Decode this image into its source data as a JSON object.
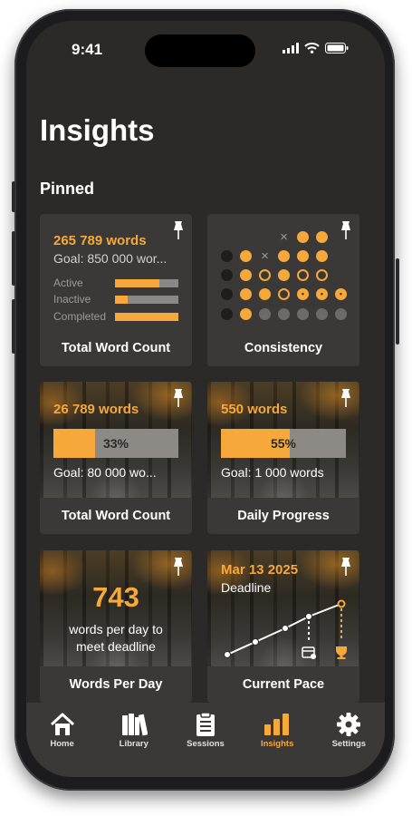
{
  "status": {
    "time": "9:41"
  },
  "page": {
    "title": "Insights",
    "section": "Pinned"
  },
  "colors": {
    "accent": "#f7a83a",
    "background": "#2b2a28",
    "card": "#3a3937"
  },
  "cards": {
    "total_word_count": {
      "headline": "265 789 words",
      "goal": "Goal: 850 000 wor...",
      "title": "Total Word Count",
      "rows": [
        {
          "label": "Active",
          "value": 0.7
        },
        {
          "label": "Inactive",
          "value": 0.2
        },
        {
          "label": "Completed",
          "value": 1.0
        }
      ]
    },
    "consistency": {
      "title": "Consistency",
      "grid": [
        [
          "none",
          "none",
          "none",
          "x",
          "filled",
          "filled"
        ],
        [
          "dark",
          "filled",
          "x",
          "filled",
          "filled",
          "filled"
        ],
        [
          "dark",
          "filled",
          "ring",
          "filled",
          "ring",
          "ring"
        ],
        [
          "dark",
          "filled",
          "filled",
          "ring",
          "flame",
          "flame",
          "flame"
        ],
        [
          "dark",
          "filled",
          "gray",
          "gray",
          "gray",
          "gray",
          "gray"
        ]
      ]
    },
    "project_word_count": {
      "headline": "26 789 words",
      "percent_label": "33%",
      "percent": 0.33,
      "goal": "Goal: 80 000 wo...",
      "title": "Total Word Count"
    },
    "daily_progress": {
      "headline": "550 words",
      "percent_label": "55%",
      "percent": 0.55,
      "goal": "Goal: 1 000 words",
      "title": "Daily Progress"
    },
    "words_per_day": {
      "value": "743",
      "caption_line1": "words per day to",
      "caption_line2": "meet deadline",
      "title": "Words Per Day"
    },
    "current_pace": {
      "date": "Mar 13 2025",
      "label": "Deadline",
      "title": "Current Pace"
    }
  },
  "tabs": [
    {
      "label": "Home",
      "icon": "home-icon"
    },
    {
      "label": "Library",
      "icon": "library-icon"
    },
    {
      "label": "Sessions",
      "icon": "clipboard-icon"
    },
    {
      "label": "Insights",
      "icon": "bar-chart-icon",
      "active": true
    },
    {
      "label": "Settings",
      "icon": "gear-icon"
    }
  ]
}
